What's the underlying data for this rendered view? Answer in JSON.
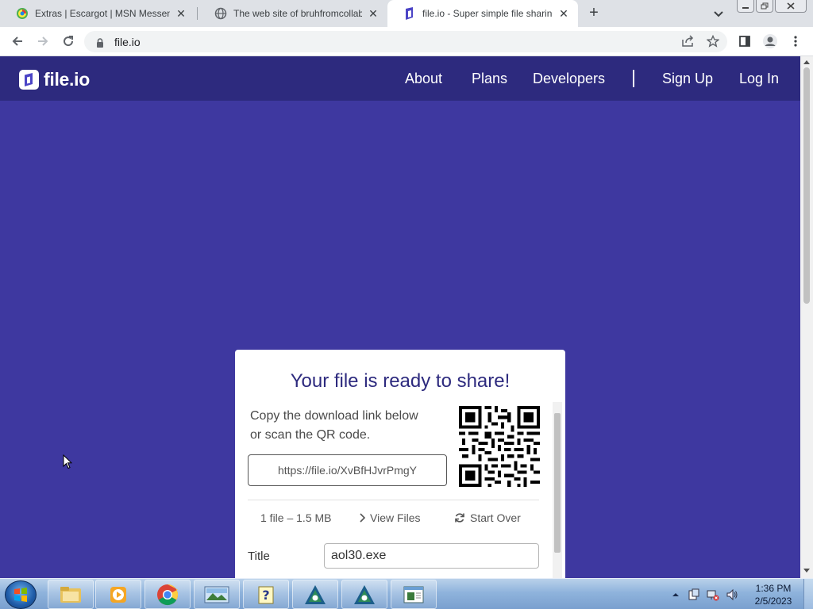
{
  "browser": {
    "tabs": [
      {
        "title": "Extras | Escargot | MSN Messeng",
        "active": false,
        "favicon": "escargot-icon"
      },
      {
        "title": "The web site of bruhfromcollaby",
        "active": false,
        "favicon": "globe-icon"
      },
      {
        "title": "file.io - Super simple file sharing",
        "active": true,
        "favicon": "file-io-icon"
      }
    ],
    "new_tab_label": "+",
    "address": "file.io"
  },
  "site": {
    "logo_text": "file.io",
    "nav": {
      "about": "About",
      "plans": "Plans",
      "developers": "Developers",
      "signup": "Sign Up",
      "login": "Log In"
    },
    "colors": {
      "header": "#2d2a7e",
      "background": "#3e38a0",
      "title": "#2d2a7e"
    }
  },
  "card": {
    "title": "Your file is ready to share!",
    "desc_line1": "Copy the download link below",
    "desc_line2": "or scan the QR code.",
    "link": "https://file.io/XvBfHJvrPmgY",
    "file_summary": "1 file – 1.5 MB",
    "view_files": "View Files",
    "start_over": "Start Over",
    "title_label": "Title",
    "title_value": "aol30.exe"
  },
  "taskbar": {
    "time": "1:36 PM",
    "date": "2/5/2023",
    "apps": [
      "explorer-icon",
      "media-player-icon",
      "chrome-icon",
      "photo-viewer-icon",
      "help-icon",
      "aol-icon",
      "aol-icon",
      "notepad-icon"
    ]
  }
}
